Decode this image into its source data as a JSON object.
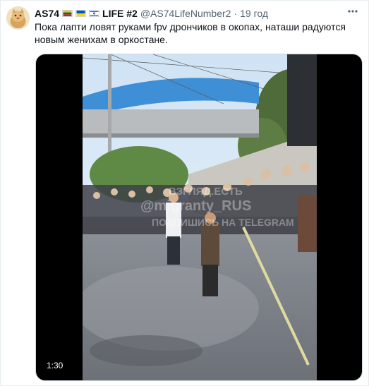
{
  "tweet": {
    "display_name": "AS74",
    "flags": [
      "lithuania-flag",
      "ukraine-flag",
      "israel-flag"
    ],
    "name_suffix": "LIFE #2",
    "handle": "@AS74LifeNumber2",
    "separator": "·",
    "time": "19 год",
    "text": "Пока лапти ловят руками fpv дрончиков в окопах, наташи радуются новым женихам в оркостане."
  },
  "media": {
    "type": "video",
    "duration": "1:30",
    "watermark_line1": "ВЗГЛЯД.ЕСТЬ",
    "watermark_line2": "@migranty_RUS",
    "watermark_line3": "ПОДПИШИСЬ НА TELEGRAM"
  },
  "icons": {
    "more": "more-icon"
  },
  "colors": {
    "text": "#0f1419",
    "secondary": "#536471",
    "border": "#cfd9de"
  }
}
